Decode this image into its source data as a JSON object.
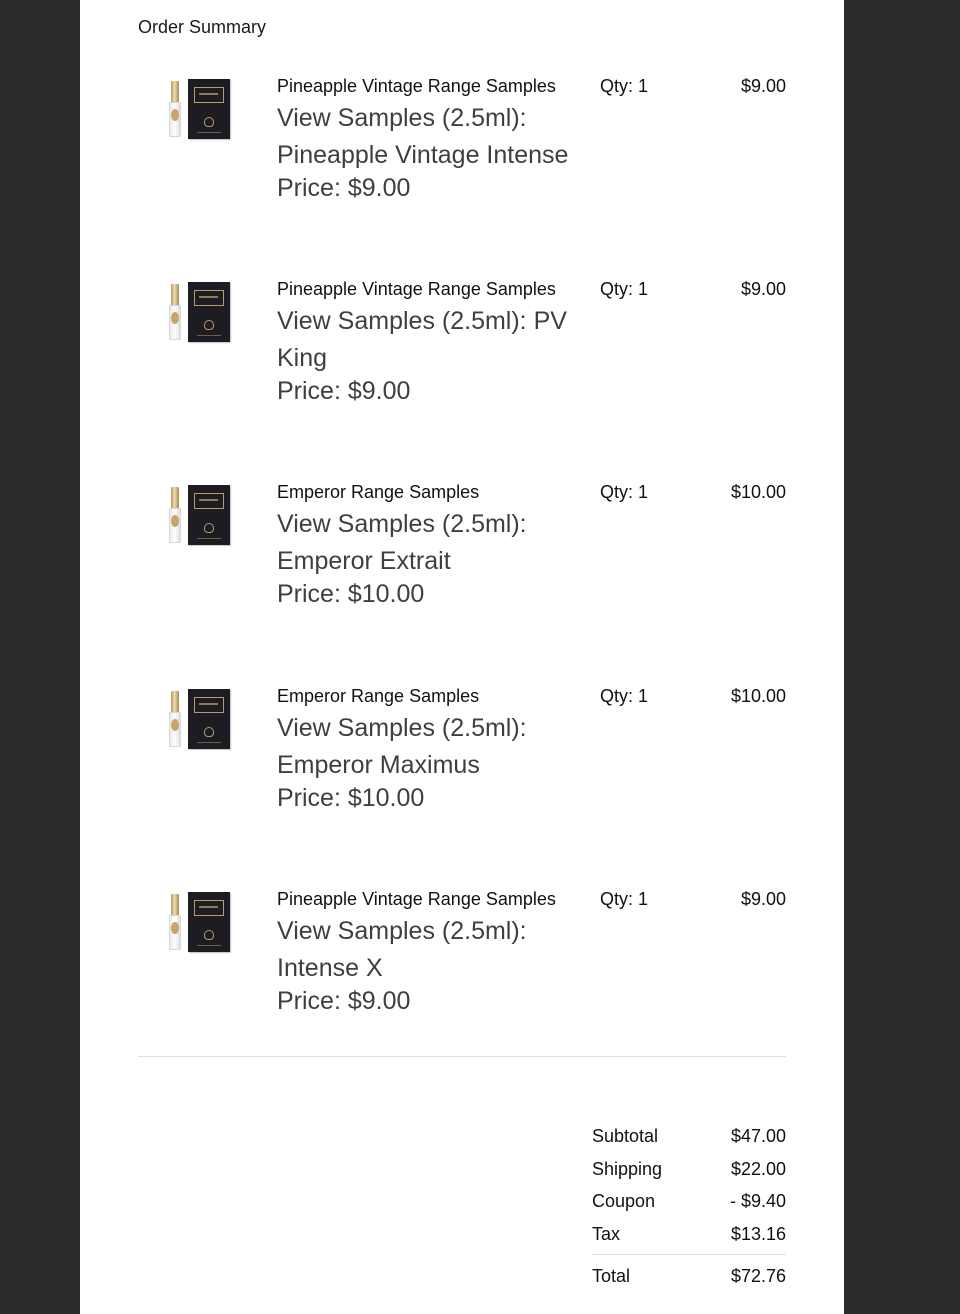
{
  "page": {
    "title": "Order Summary"
  },
  "items": [
    {
      "product": "Pineapple Vintage Range Samples",
      "variant": "View Samples (2.5ml): Pineapple Vintage Intense",
      "price": "Price: $9.00",
      "qty": "Qty: 1",
      "amount": "$9.00"
    },
    {
      "product": "Pineapple Vintage Range Samples",
      "variant": "View Samples (2.5ml): PV King",
      "price": "Price: $9.00",
      "qty": "Qty: 1",
      "amount": "$9.00"
    },
    {
      "product": "Emperor Range Samples",
      "variant": "View Samples (2.5ml): Emperor Extrait",
      "price": "Price: $10.00",
      "qty": "Qty: 1",
      "amount": "$10.00"
    },
    {
      "product": "Emperor Range Samples",
      "variant": "View Samples (2.5ml): Emperor Maximus",
      "price": "Price: $10.00",
      "qty": "Qty: 1",
      "amount": "$10.00"
    },
    {
      "product": "Pineapple Vintage Range Samples",
      "variant": "View Samples (2.5ml): Intense X",
      "price": "Price: $9.00",
      "qty": "Qty: 1",
      "amount": "$9.00"
    }
  ],
  "totals": {
    "subtotal_label": "Subtotal",
    "subtotal": "$47.00",
    "shipping_label": "Shipping",
    "shipping": "$22.00",
    "coupon_label": "Coupon",
    "coupon": "- $9.40",
    "tax_label": "Tax",
    "tax": "$13.16",
    "total_label": "Total",
    "total": "$72.76"
  },
  "colors": {
    "background": "#2b2b2d",
    "page": "#ffffff",
    "box": "#1c1c22",
    "gold": "#b89b6a"
  },
  "icons": {
    "product_image": "sample-vial-and-box-icon"
  }
}
